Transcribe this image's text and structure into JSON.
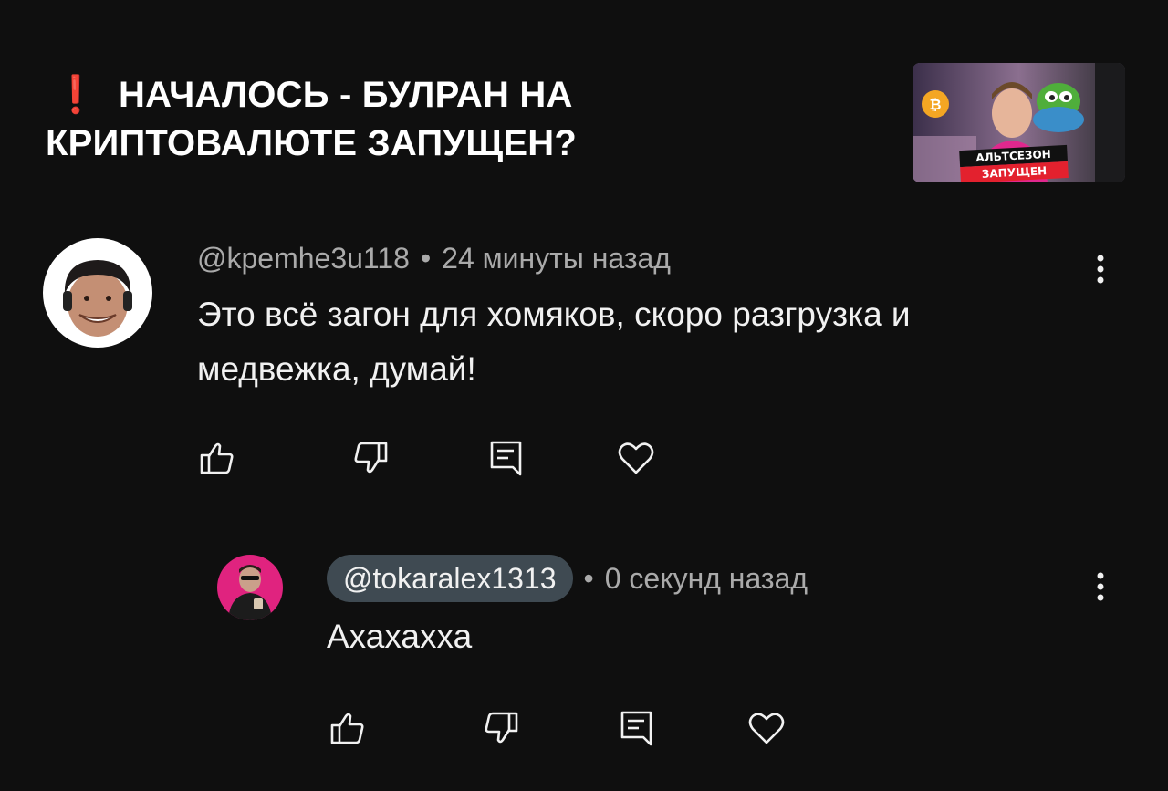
{
  "video": {
    "title_icon": "❗",
    "title": "НАЧАЛОСЬ - БУЛРАН НА КРИПТОВАЛЮТЕ ЗАПУЩЕН?",
    "thumbnail": {
      "line1": "АЛЬТСЕЗОН",
      "line2": "ЗАПУЩЕН"
    }
  },
  "comments": [
    {
      "author": "@kpemhe3u118",
      "separator": "•",
      "time": "24 минуты назад",
      "text": "Это всё загон для хомяков, скоро разгрузка и медвежка, думай!"
    }
  ],
  "reply": {
    "author": "@tokaralex1313",
    "separator": "•",
    "time": "0 секунд назад",
    "text": "Ахахахха"
  },
  "colors": {
    "background": "#0f0f0f",
    "text": "#f1f1f1",
    "meta": "#aaaaaa",
    "author_chip": "#3f4a52",
    "accent_red": "#e0202a"
  }
}
